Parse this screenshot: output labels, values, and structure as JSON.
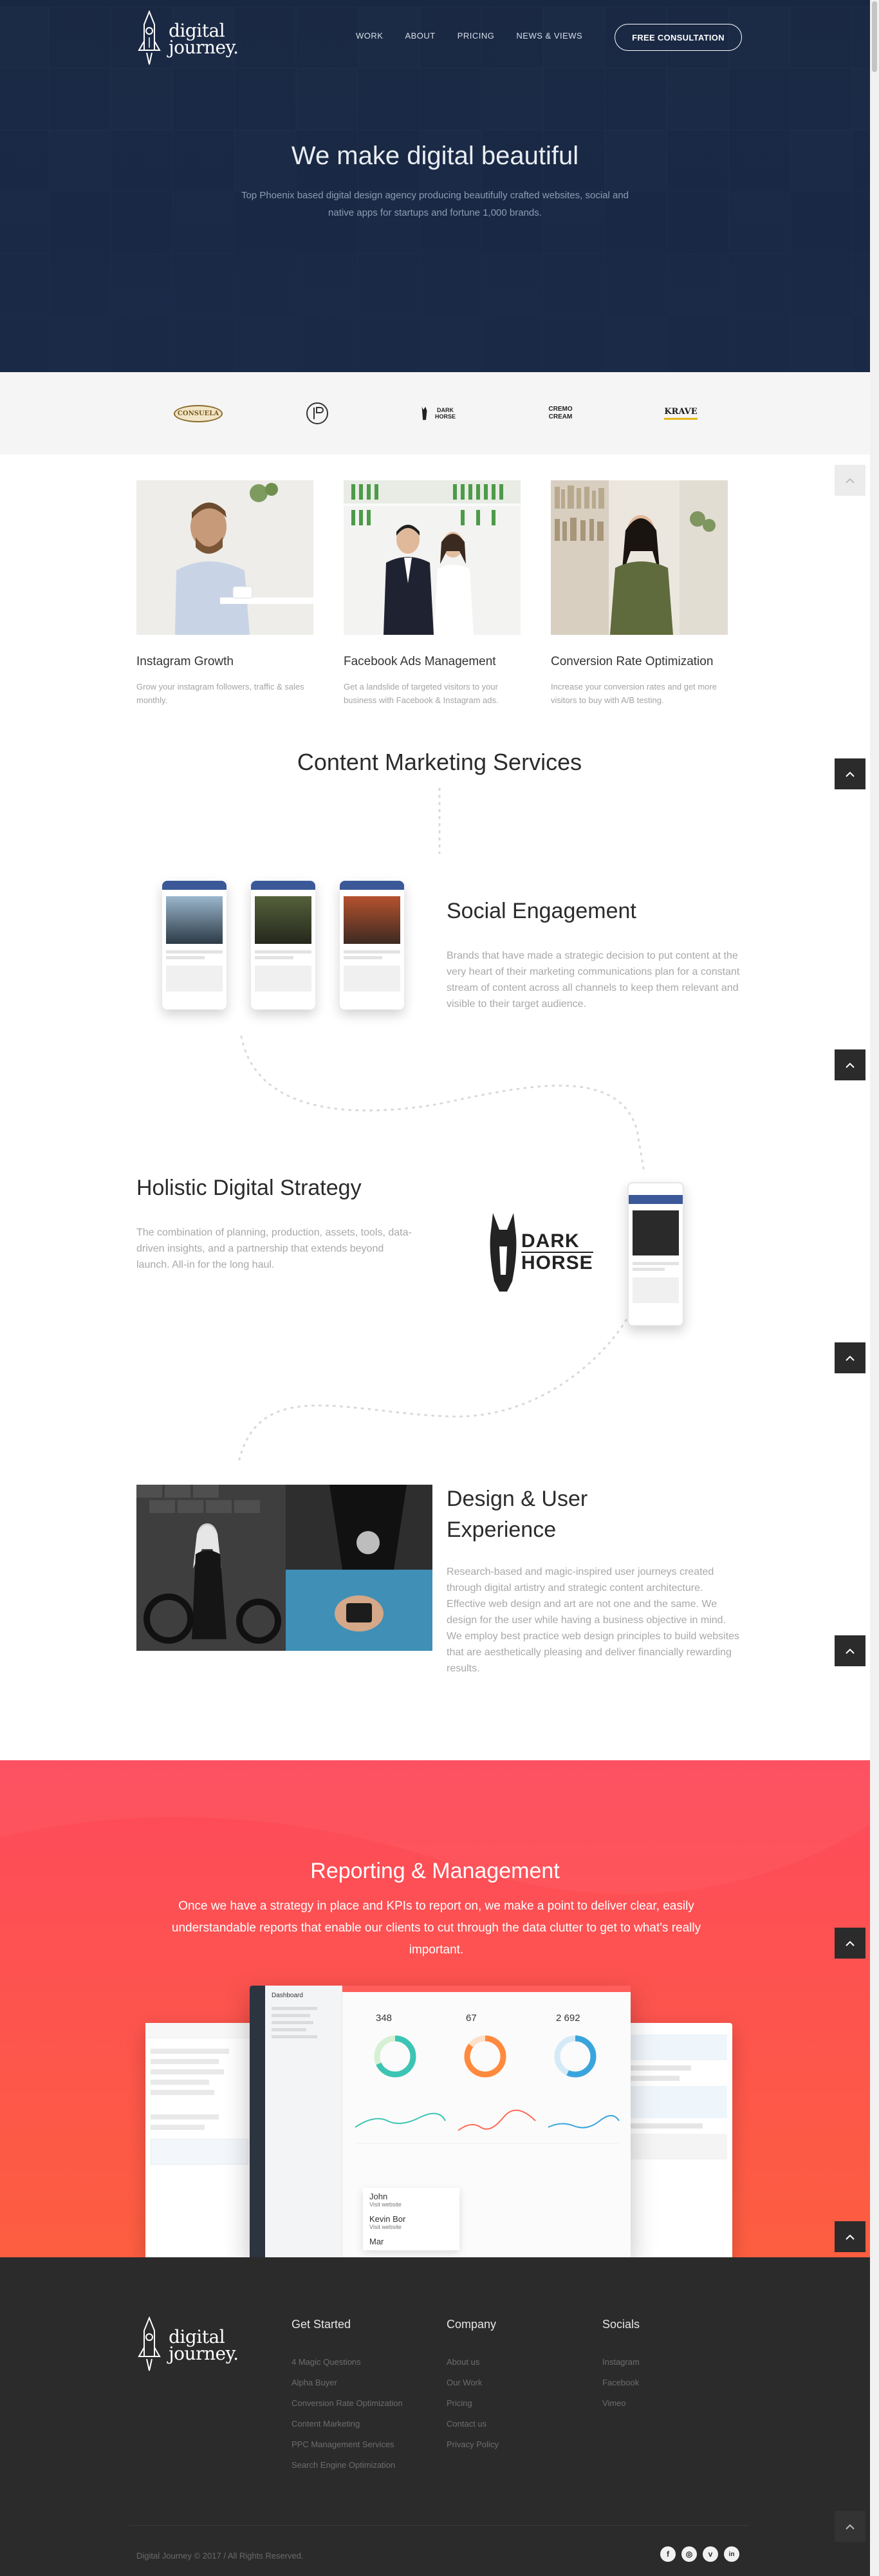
{
  "brand": {
    "line1": "digital",
    "line2": "journey."
  },
  "nav": {
    "items": [
      {
        "label": "WORK"
      },
      {
        "label": "ABOUT"
      },
      {
        "label": "PRICING"
      },
      {
        "label": "NEWS & VIEWS"
      }
    ],
    "cta": "FREE CONSULTATION"
  },
  "hero": {
    "title": "We make digital beautiful",
    "subtitle": "Top Phoenix based digital design agency producing beautifully crafted websites, social and native apps for startups and fortune 1,000 brands."
  },
  "clients": [
    {
      "name": "CONSUELA"
    },
    {
      "name": ""
    },
    {
      "name": "DARK HORSE"
    },
    {
      "name": "CREMO CREAM"
    },
    {
      "name": "KRAVE"
    }
  ],
  "services": [
    {
      "title": "Instagram Growth",
      "desc": "Grow your instagram followers, traffic & sales monthly."
    },
    {
      "title": "Facebook Ads Management",
      "desc": "Get a landslide of targeted visitors to your business with Facebook & Instagram ads."
    },
    {
      "title": "Conversion Rate Optimization",
      "desc": "Increase your conversion rates and get more visitors to buy with A/B testing."
    }
  ],
  "content_marketing": {
    "title": "Content Marketing Services",
    "social": {
      "title": "Social Engagement",
      "text": "Brands that have made a strategic decision to put content at the very heart of their marketing communications plan for a constant stream of content across all channels to keep them relevant and visible to their target audience."
    },
    "holistic": {
      "title": "Holistic Digital Strategy",
      "text": "The combination of planning, production, assets, tools, data-driven insights, and a partnership that extends beyond launch. All-in for the long haul.",
      "logo_line1": "DARK",
      "logo_line2": "HORSE"
    },
    "design": {
      "title_line1": "Design & User",
      "title_line2": "Experience",
      "text": "Research-based and magic-inspired user journeys created through digital artistry and strategic content architecture. Effective web design and art are not one and the same. We design for the user while having a business objective in mind. We employ best practice web design principles to build websites that are aesthetically pleasing and deliver financially rewarding results."
    }
  },
  "reporting": {
    "title": "Reporting & Management",
    "text": "Once we have a strategy in place and KPIs to report on, we make a point to deliver clear, easily understandable reports that enable our clients to cut through the data clutter to get to what's really important.",
    "dashboard": {
      "heading": "Dashboard",
      "stats": [
        {
          "value": "348"
        },
        {
          "value": "67"
        },
        {
          "value": "2 692"
        }
      ],
      "contacts": [
        {
          "name": "John",
          "note": "Visit website"
        },
        {
          "name": "Kevin Bor",
          "note": "Visit website"
        },
        {
          "name": "Mar",
          "note": ""
        }
      ]
    }
  },
  "footer": {
    "columns": [
      {
        "heading": "Get Started",
        "links": [
          "4 Magic Questions",
          "Alpha Buyer",
          "Conversion Rate Optimization",
          "Content Marketing",
          "PPC Management Services",
          "Search Engine Optimization"
        ]
      },
      {
        "heading": "Company",
        "links": [
          "About us",
          "Our Work",
          "Pricing",
          "Contact us",
          "Privacy Policy"
        ]
      },
      {
        "heading": "Socials",
        "links": [
          "Instagram",
          "Facebook",
          "Vimeo"
        ]
      }
    ],
    "copyright": "Digital Journey © 2017 / All Rights Reserved.",
    "social_icons": [
      {
        "icon": "facebook-icon",
        "glyph": "f"
      },
      {
        "icon": "instagram-icon",
        "glyph": "◎"
      },
      {
        "icon": "vimeo-icon",
        "glyph": "v"
      },
      {
        "icon": "linkedin-icon",
        "glyph": "in"
      }
    ]
  }
}
